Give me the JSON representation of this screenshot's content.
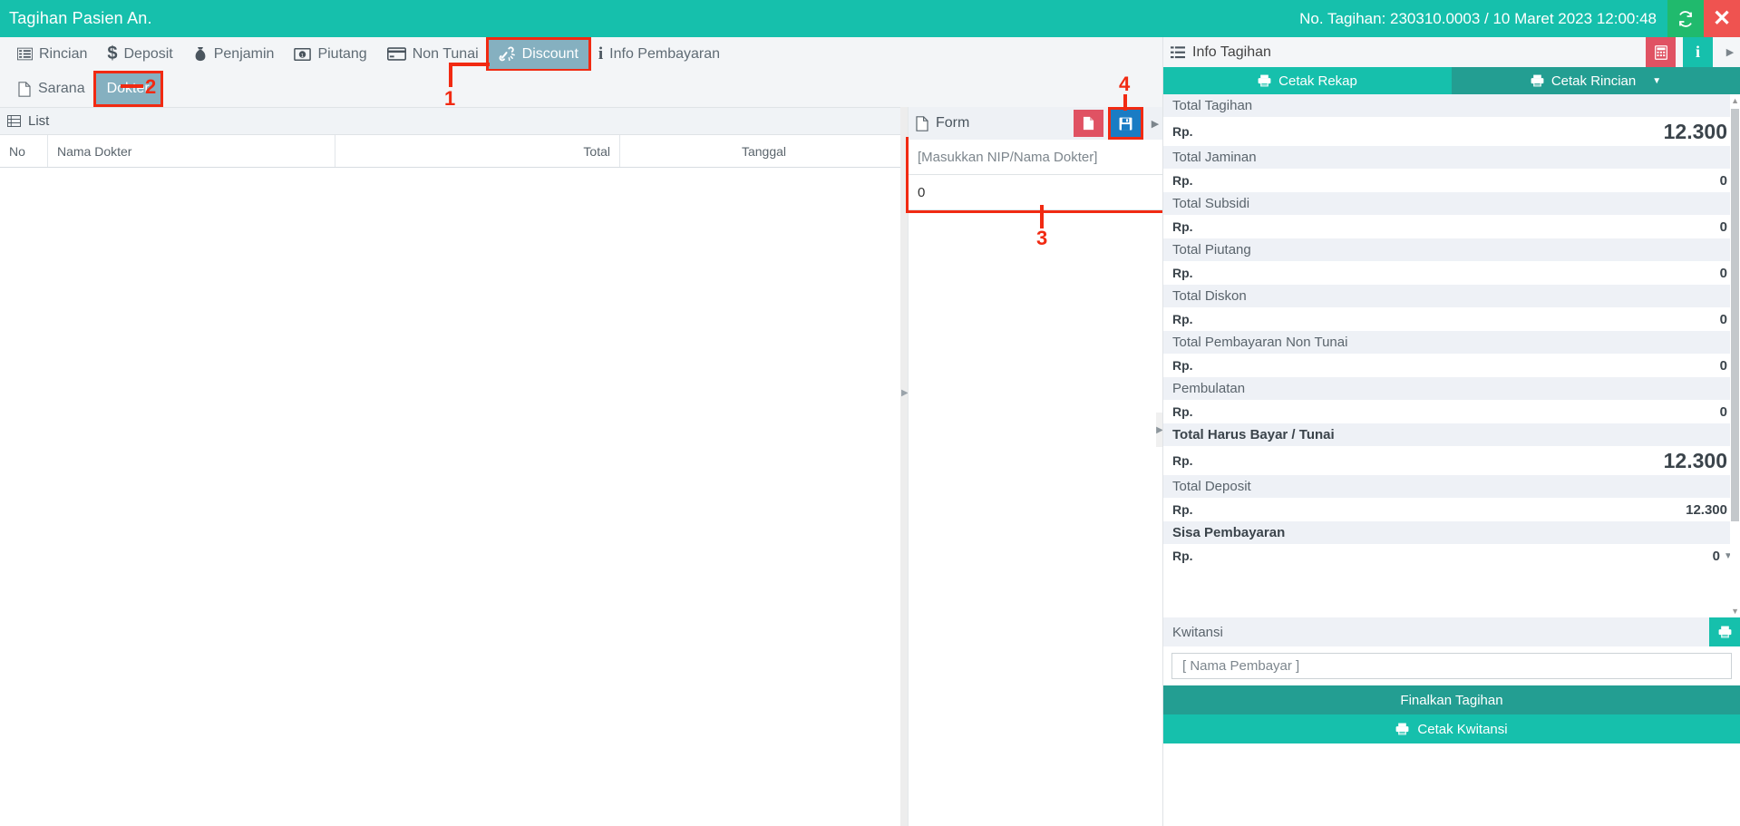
{
  "window": {
    "title": "Tagihan Pasien An.",
    "bill_info": "No. Tagihan: 230310.0003 / 10 Maret 2023 12:00:48",
    "refresh_icon": "refresh-icon",
    "close_icon": "close-icon"
  },
  "toolbar": {
    "items": [
      {
        "label": "Rincian",
        "icon": "list-icon",
        "active": false
      },
      {
        "label": "Deposit",
        "icon": "dollar-icon",
        "active": false
      },
      {
        "label": "Penjamin",
        "icon": "moneybag-icon",
        "active": false
      },
      {
        "label": "Piutang",
        "icon": "banknote-icon",
        "active": false
      },
      {
        "label": "Non Tunai",
        "icon": "creditcard-icon",
        "active": false
      },
      {
        "label": "Discount",
        "icon": "discount-icon",
        "active": true
      },
      {
        "label": "Info Pembayaran",
        "icon": "info-icon",
        "active": false
      }
    ]
  },
  "subtoolbar": {
    "items": [
      {
        "label": "Sarana",
        "icon": "file-icon",
        "active": false
      },
      {
        "label": "Dokter",
        "icon": "",
        "active": true
      }
    ]
  },
  "list_panel": {
    "title": "List",
    "title_icon": "table-icon",
    "columns": [
      "No",
      "Nama Dokter",
      "Total",
      "Tanggal"
    ],
    "rows": []
  },
  "form_panel": {
    "title": "Form",
    "title_icon": "file-icon",
    "new_button_icon": "new-document-icon",
    "save_button_icon": "save-disk-icon",
    "expand_icon": "caret-right-icon",
    "fields": {
      "doctor_placeholder": "[Masukkan NIP/Nama Dokter]",
      "amount_value": "0"
    }
  },
  "info_panel": {
    "title": "Info Tagihan",
    "title_icon": "list-icon",
    "calculator_icon": "calculator-icon",
    "info_icon": "info-icon",
    "expand_icon": "caret-right-icon",
    "print_tabs": [
      {
        "label": "Cetak Rekap",
        "icon": "printer-icon",
        "selected": true
      },
      {
        "label": "Cetak Rincian",
        "icon": "printer-icon",
        "selected": false
      }
    ],
    "print_tabs_caret": "caret-down-icon",
    "currency": "Rp.",
    "rows": [
      {
        "label": "Total Tagihan",
        "value": "12.300",
        "big": true,
        "bold": false
      },
      {
        "label": "Total Jaminan",
        "value": "0",
        "big": false,
        "bold": false
      },
      {
        "label": "Total Subsidi",
        "value": "0",
        "big": false,
        "bold": false
      },
      {
        "label": "Total Piutang",
        "value": "0",
        "big": false,
        "bold": false
      },
      {
        "label": "Total Diskon",
        "value": "0",
        "big": false,
        "bold": false
      },
      {
        "label": "Total Pembayaran Non Tunai",
        "value": "0",
        "big": false,
        "bold": false
      },
      {
        "label": "Pembulatan",
        "value": "0",
        "big": false,
        "bold": false
      },
      {
        "label": "Total Harus Bayar / Tunai",
        "value": "12.300",
        "big": true,
        "bold": true
      },
      {
        "label": "Total Deposit",
        "value": "12.300",
        "big": false,
        "bold": false
      },
      {
        "label": "Sisa Pembayaran",
        "value": "0",
        "big": false,
        "bold": true,
        "caret": true
      }
    ],
    "kwitansi": {
      "label": "Kwitansi",
      "print_icon": "printer-icon",
      "payer_placeholder": "[ Nama Pembayar ]"
    },
    "finalize_button": "Finalkan Tagihan",
    "print_receipt_button": "Cetak Kwitansi",
    "print_receipt_icon": "printer-icon",
    "scroll_up_icon": "caret-up-icon",
    "scroll_down_icon": "caret-down-icon"
  },
  "annotations": [
    {
      "number": "1",
      "target": "discount-toolbar-button"
    },
    {
      "number": "2",
      "target": "dokter-subtab"
    },
    {
      "number": "3",
      "target": "form-fields-group"
    },
    {
      "number": "4",
      "target": "form-save-button"
    }
  ],
  "colors": {
    "brand_teal": "#16c0ac",
    "dark_teal": "#239e92",
    "active_tab": "#85b0c0",
    "annotation_red": "#f12a12",
    "save_blue": "#1a7cc4",
    "new_red": "#e05263",
    "close_red": "#ef5350",
    "refresh_green": "#20ba6d"
  }
}
